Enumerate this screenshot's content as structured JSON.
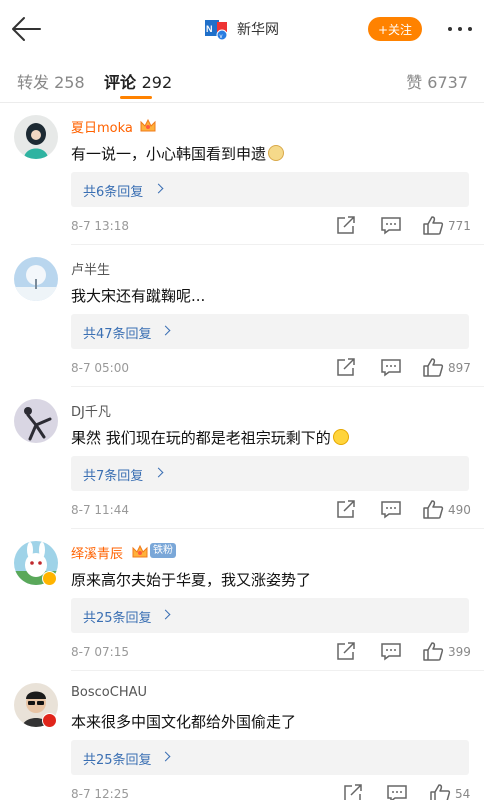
{
  "header": {
    "title": "新华网",
    "follow_label": "+关注",
    "logo_text": "新华网"
  },
  "tabs": {
    "repost": "转发 258",
    "comment_label": "评论",
    "comment_count": "292",
    "like": "赞 6737"
  },
  "colors": {
    "accent": "#ff8200",
    "link": "#3a6fb3",
    "orange_name": "#ff6200"
  },
  "comments": [
    {
      "username": "夏日moka",
      "text": "有一说一，小心韩国看到申遗",
      "emoji": "doge",
      "replies": "共6条回复",
      "time": "8-7 13:18",
      "likes": "771"
    },
    {
      "username": "卢半生",
      "text": "我大宋还有蹴鞠呢...",
      "replies": "共47条回复",
      "time": "8-7 05:00",
      "likes": "897"
    },
    {
      "username": "DJ千凡",
      "text": "果然 我们现在玩的都是老祖宗玩剩下的",
      "emoji": "laugh",
      "replies": "共7条回复",
      "time": "8-7 11:44",
      "likes": "490"
    },
    {
      "username": "绎溪青辰",
      "fan_badge": "铁粉",
      "text": "原来高尔夫始于华夏，我又涨姿势了",
      "replies": "共25条回复",
      "time": "8-7 07:15",
      "likes": "399"
    },
    {
      "username": "BoscoCHAU",
      "text": "本来很多中国文化都给外国偷走了",
      "replies": "共25条回复",
      "time": "8-7 12:25",
      "likes": "54"
    }
  ]
}
